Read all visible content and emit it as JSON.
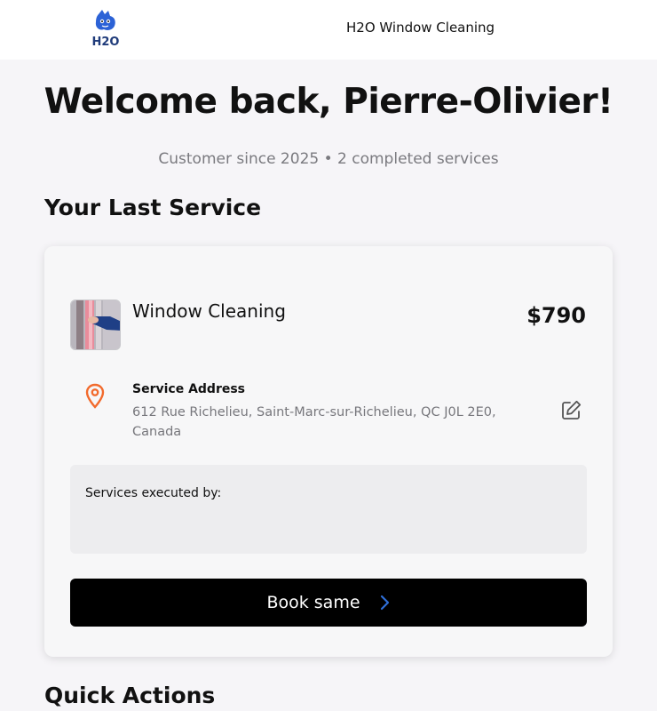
{
  "header": {
    "logo_text": "H2O",
    "brand_name": "H2O Window Cleaning"
  },
  "welcome": {
    "title": "Welcome back, Pierre-Olivier!",
    "subtitle": "Customer since 2025 • 2 completed services"
  },
  "last_service": {
    "section_title": "Your Last Service",
    "service_name": "Window Cleaning",
    "price": "$790",
    "address_label": "Service Address",
    "address": "612 Rue Richelieu, Saint-Marc-sur-Richelieu, QC J0L 2E0, Canada",
    "executed_by_label": "Services executed by:",
    "book_button_label": "Book same"
  },
  "quick_actions": {
    "section_title": "Quick Actions"
  },
  "icons": {
    "pin": "map-pin-icon",
    "edit": "edit-icon",
    "chevron": "chevron-right-icon"
  },
  "colors": {
    "accent_orange": "#f26a2c",
    "chevron_blue": "#2f6fd8",
    "logo_blue": "#2c62d6"
  }
}
